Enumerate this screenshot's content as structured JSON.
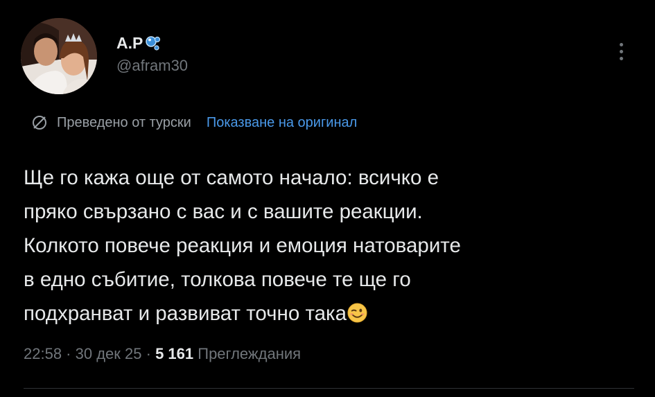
{
  "post": {
    "author": {
      "display_name": "A.P",
      "handle": "@afram30",
      "avatar_icon": "couple-photo-avatar",
      "name_emoji": "bubbles-icon"
    },
    "more_icon": "more-vertical-icon",
    "translation": {
      "icon": "translate-icon",
      "label": "Преведено от турски",
      "action": "Показване на оригинал"
    },
    "text_lines": [
      "Ще го кажа още от самото начало: всичко е",
      "пряко свързано с вас и с вашите реакции.",
      "Колкото повече реакция и емоция натоварите",
      "в едно събитие, толкова повече те ще го",
      "подхранват и развиват точно така"
    ],
    "end_emoji": "winking-face-icon",
    "meta": {
      "time": "22:58",
      "separator": " · ",
      "date": "30 дек 25",
      "views_count": "5 161",
      "views_label": "Преглеждания"
    },
    "colors": {
      "background": "#000000",
      "text": "#e7e9ea",
      "muted": "#71767b",
      "link": "#4a99e9"
    }
  }
}
